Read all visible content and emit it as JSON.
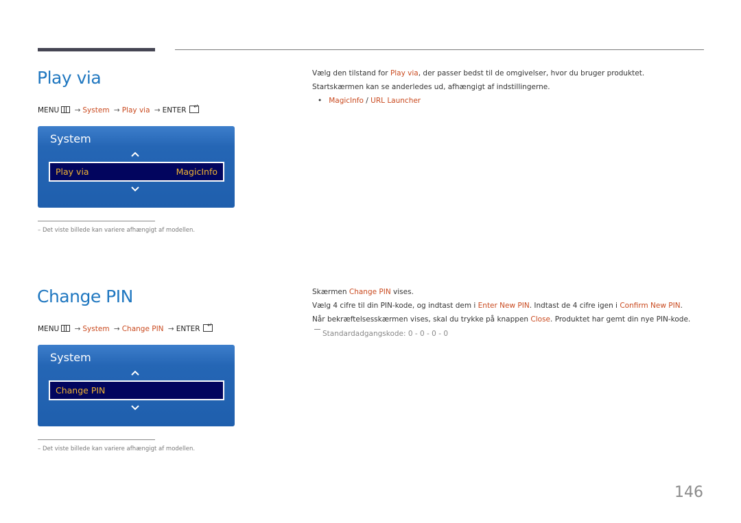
{
  "page": {
    "number": "146"
  },
  "sections": [
    {
      "title": "Play via",
      "menu_path": {
        "menu": "MENU",
        "arrow": "→",
        "system": "System",
        "item": "Play via",
        "enter": "ENTER"
      },
      "osd": {
        "title": "System",
        "item_label": "Play via",
        "item_value": "MagicInfo"
      },
      "note": "–  Det viste billede kan variere afhængigt af modellen.",
      "description": {
        "line1_before": "Vælg den tilstand for ",
        "line1_hl": "Play via",
        "line1_after": ", der passer bedst til de omgivelser, hvor du bruger produktet.",
        "line2": "Startskærmen kan se anderledes ud, afhængigt af indstillingerne.",
        "bullet_dot": "•",
        "option1": "MagicInfo",
        "option_sep": " / ",
        "option2": "URL Launcher"
      }
    },
    {
      "title": "Change PIN",
      "menu_path": {
        "menu": "MENU",
        "arrow": "→",
        "system": "System",
        "item": "Change PIN",
        "enter": "ENTER"
      },
      "osd": {
        "title": "System",
        "item_label": "Change PIN",
        "item_value": ""
      },
      "note": "–  Det viste billede kan variere afhængigt af modellen.",
      "description": {
        "line1_before": "Skærmen ",
        "line1_hl": "Change PIN",
        "line1_after": " vises.",
        "line2_before": "Vælg 4 cifre til din PIN-kode, og indtast dem i ",
        "line2_hl1": "Enter New PIN",
        "line2_mid": ". Indtast de 4 cifre igen i ",
        "line2_hl2": "Confirm New PIN",
        "line2_after": ".",
        "line3_before": "Når bekræftelsesskærmen vises, skal du trykke på knappen ",
        "line3_hl": "Close",
        "line3_after": ". Produktet har gemt din nye PIN-kode.",
        "std_note": "Standardadgangskode: 0 - 0 - 0 - 0"
      }
    }
  ]
}
